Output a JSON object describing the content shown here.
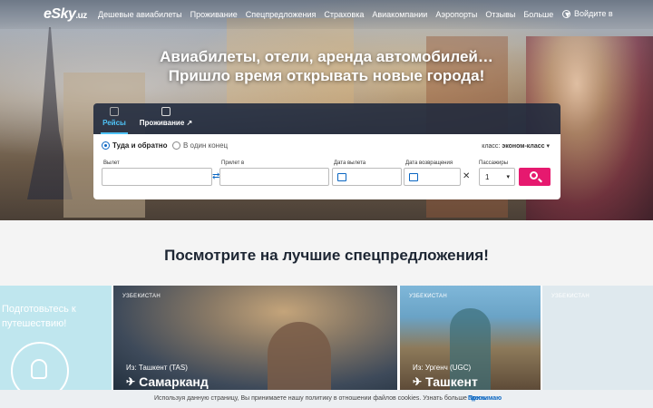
{
  "header": {
    "logo": "eSky",
    "logo_suffix": ".uz",
    "nav": [
      "Дешевые авиабилеты",
      "Проживание",
      "Спецпредложения",
      "Страховка",
      "Авиакомпании",
      "Аэропорты",
      "Отзывы",
      "Больше"
    ],
    "login": "Войдите в"
  },
  "hero": {
    "headline_1": "Авиабилеты, отели, аренда автомобилей…",
    "headline_2": "Пришло время открывать новые города!"
  },
  "search": {
    "tabs": [
      "Рейсы",
      "Проживание"
    ],
    "trip_round": "Туда и обратно",
    "trip_oneway": "В один конец",
    "class_label": "класс:",
    "class_value": "эконом-класс",
    "from_label": "Вылет",
    "to_label": "Прилет в",
    "depart_label": "Дата вылета",
    "return_label": "Дата возвращения",
    "passengers_label": "Пассажиры",
    "passengers_value": "1",
    "from_value": "",
    "to_value": ""
  },
  "offers": {
    "title": "Посмотрите на лучшие спецпредложения!",
    "promo_text_1": "Подготовьтесь к",
    "promo_text_2": "путешествию!",
    "cards": [
      {
        "country": "УЗБЕКИСТАН",
        "from": "Из: Ташкент (TAS)",
        "city": "Самарканд"
      },
      {
        "country": "УЗБЕКИСТАН",
        "from": "Из: Ургенч (UGC)",
        "city": "Ташкент"
      },
      {
        "country": "УЗБЕКИСТАН"
      }
    ]
  },
  "cookie": {
    "message": "Используя данную страницу, Вы принимаете нашу политику в отношении файлов cookies. Узнать больше ",
    "link": "здесь.",
    "accept": "Принимаю"
  }
}
